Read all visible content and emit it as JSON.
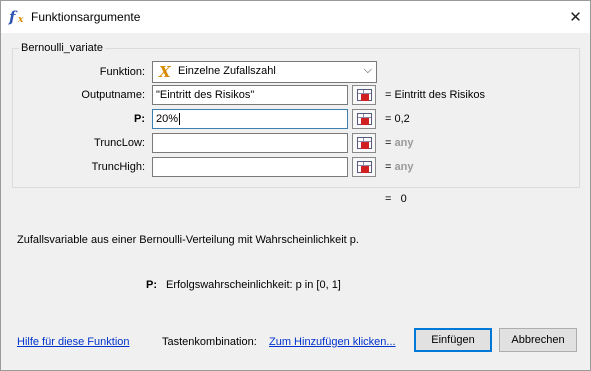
{
  "window": {
    "title": "Funktionsargumente",
    "close_glyph": "✕"
  },
  "group": {
    "legend": "Bernoulli_variate"
  },
  "function_row": {
    "label": "Funktion:",
    "icon_glyph": "X",
    "selected": "Einzelne Zufallszahl",
    "arrow_glyph": "⌵"
  },
  "rows": [
    {
      "label": "Outputname:",
      "value": "\"Eintritt des Risikos\"",
      "result": "= Eintritt des Risikos",
      "result_any": ""
    },
    {
      "label": "P:",
      "value": "20%",
      "result": "= 0,2",
      "result_any": ""
    },
    {
      "label": "TruncLow:",
      "value": "",
      "result": "= ",
      "result_any": "any"
    },
    {
      "label": "TruncHigh:",
      "value": "",
      "result": "= ",
      "result_any": "any"
    }
  ],
  "overall_result": "=   0",
  "description": "Zufallsvariable aus einer Bernoulli-Verteilung mit Wahrscheinlichkeit p.",
  "param_help": {
    "name": "P:",
    "text": "Erfolgswahrscheinlichkeit: p in [0, 1]"
  },
  "footer": {
    "help_link": "Hilfe für diese Funktion",
    "shortcut_label": "Tastenkombination:",
    "shortcut_link": "Zum Hinzufügen klicken...",
    "insert_button": "Einfügen",
    "cancel_button": "Abbrechen"
  },
  "colors": {
    "accent": "#0078d7",
    "link": "#0033cc",
    "any_gray": "#9a9a9a"
  }
}
